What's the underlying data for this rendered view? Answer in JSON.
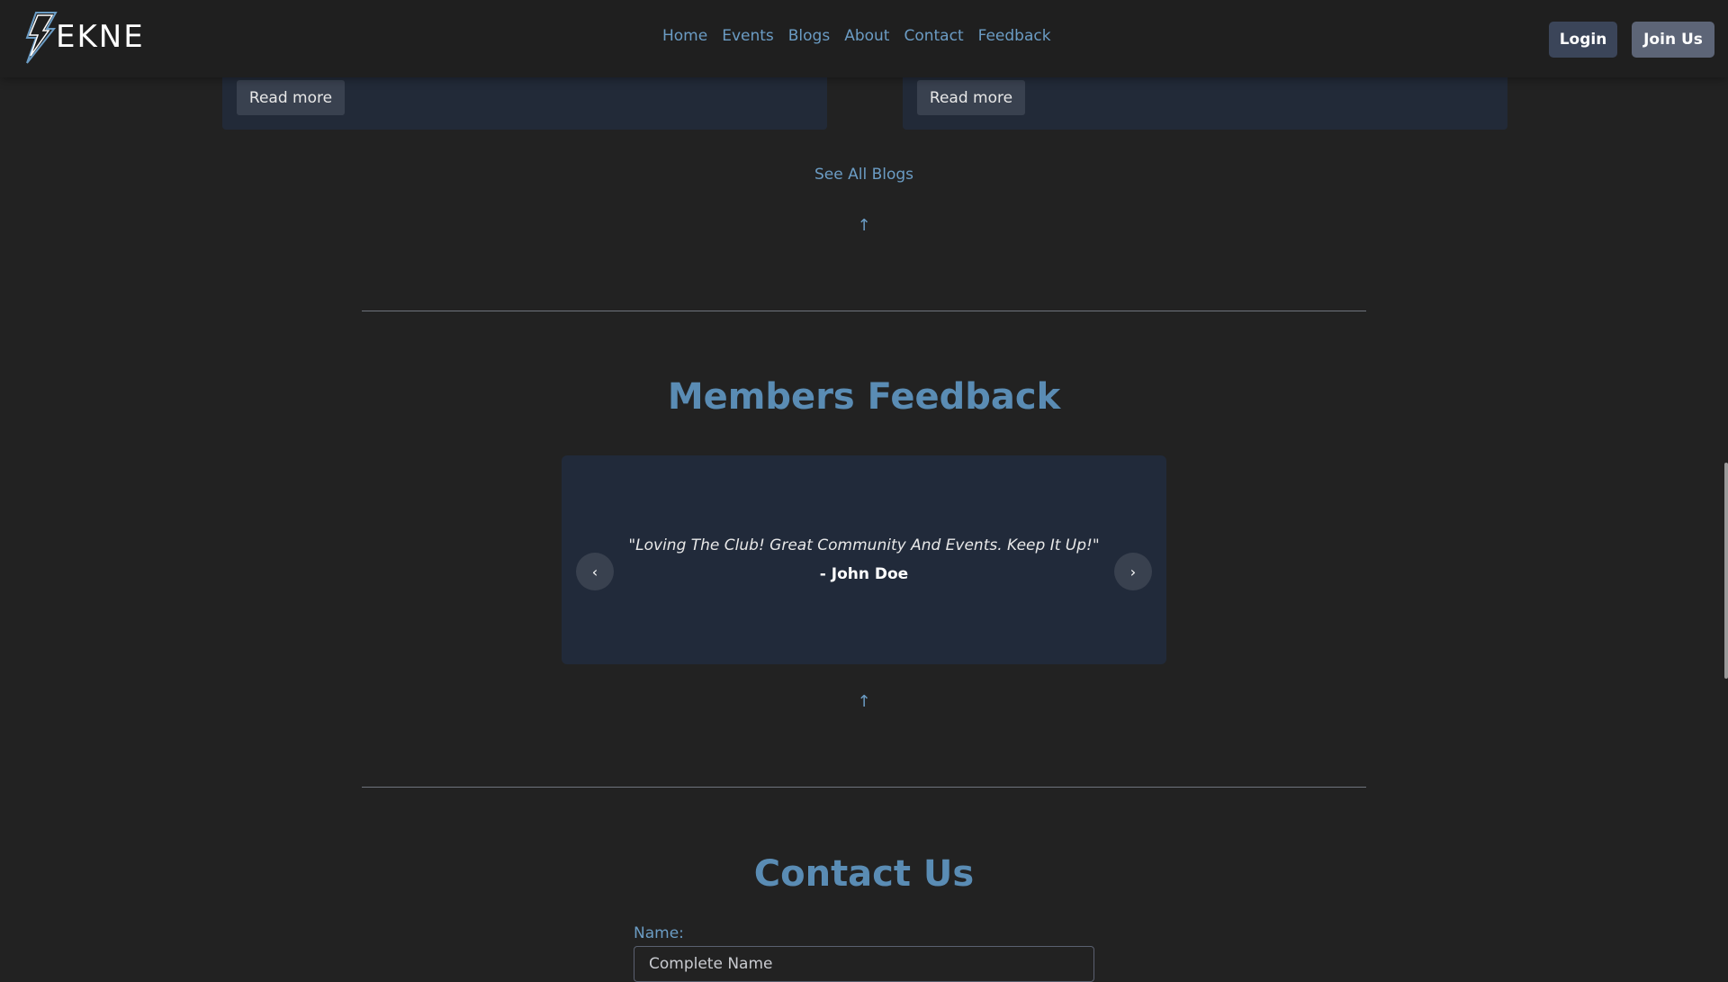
{
  "brand": {
    "logo_text": "EKNE"
  },
  "nav": {
    "items": [
      "Home",
      "Events",
      "Blogs",
      "About",
      "Contact",
      "Feedback"
    ]
  },
  "auth": {
    "login_label": "Login",
    "join_label": "Join Us"
  },
  "blogs": {
    "cards": [
      {
        "read_more_label": "Read more"
      },
      {
        "read_more_label": "Read more"
      }
    ],
    "see_all_label": "See All Blogs"
  },
  "feedback": {
    "title": "Members Feedback",
    "quote": "\"Loving The Club! Great Community And Events. Keep It Up!\"",
    "author": "- John Doe",
    "prev_label": "‹",
    "next_label": "›"
  },
  "contact": {
    "title": "Contact Us",
    "name_label": "Name:",
    "name_placeholder": "Complete Name"
  },
  "colors": {
    "background": "#222222",
    "accent": "#5a8cb4",
    "link": "#6b9cc4",
    "card": "#212a3a"
  }
}
